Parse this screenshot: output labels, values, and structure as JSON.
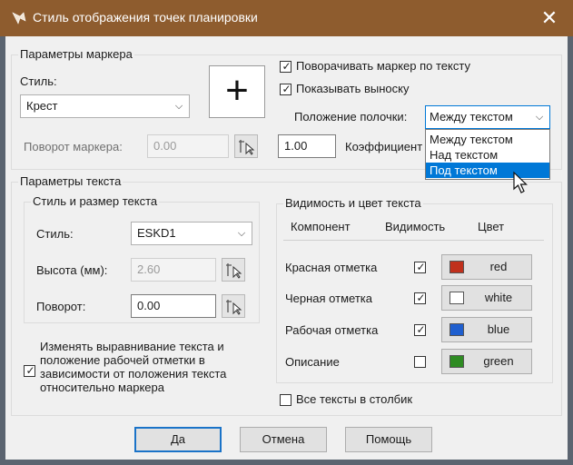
{
  "window": {
    "title": "Стиль отображения  точек планировки",
    "close_glyph": "✕"
  },
  "marker": {
    "group_label": "Параметры маркера",
    "style_label": "Стиль:",
    "style_value": "Крест",
    "preview_glyph": "+",
    "rotate_with_text_label": "Поворачивать маркер по тексту",
    "rotate_with_text_checked": true,
    "show_leader_label": "Показывать выноску",
    "show_leader_checked": true,
    "shelf_position_label": "Положение полочки:",
    "shelf_position_value": "Между текстом",
    "shelf_position_options": [
      "Между текстом",
      "Над текстом",
      "Под текстом"
    ],
    "shelf_position_highlighted": "Под текстом",
    "rotation_label": "Поворот маркера:",
    "rotation_value": "0.00",
    "coef_value": "1.00",
    "coef_label": "Коэффициент"
  },
  "text": {
    "group_label": "Параметры текста",
    "style_group_label": "Стиль и размер текста",
    "style_label": "Стиль:",
    "style_value": "ESKD1",
    "height_label": "Высота (мм):",
    "height_value": "2.60",
    "rotation_label": "Поворот:",
    "rotation_value": "0.00",
    "visibility_group_label": "Видимость и цвет текста",
    "columns": {
      "component": "Компонент",
      "visibility": "Видимость",
      "color": "Цвет"
    },
    "rows": [
      {
        "name": "Красная отметка",
        "visible": true,
        "color_name": "red",
        "swatch": "#c0301c"
      },
      {
        "name": "Черная отметка",
        "visible": true,
        "color_name": "white",
        "swatch": "#ffffff"
      },
      {
        "name": "Рабочая отметка",
        "visible": true,
        "color_name": "blue",
        "swatch": "#1f5fcf"
      },
      {
        "name": "Описание",
        "visible": false,
        "color_name": "green",
        "swatch": "#2e8b22"
      }
    ],
    "align_label": "Изменять выравнивание текста и положение рабочей отметки в зависимости от положения текста относительно маркера",
    "align_checked": true,
    "all_in_column_label": "Все тексты в столбик",
    "all_in_column_checked": false
  },
  "buttons": {
    "ok": "Да",
    "cancel": "Отмена",
    "help": "Помощь"
  },
  "colors": {
    "titlebar": "#8e5c2e",
    "dialog_bg": "#f0f0f0",
    "accent": "#0078d7"
  }
}
